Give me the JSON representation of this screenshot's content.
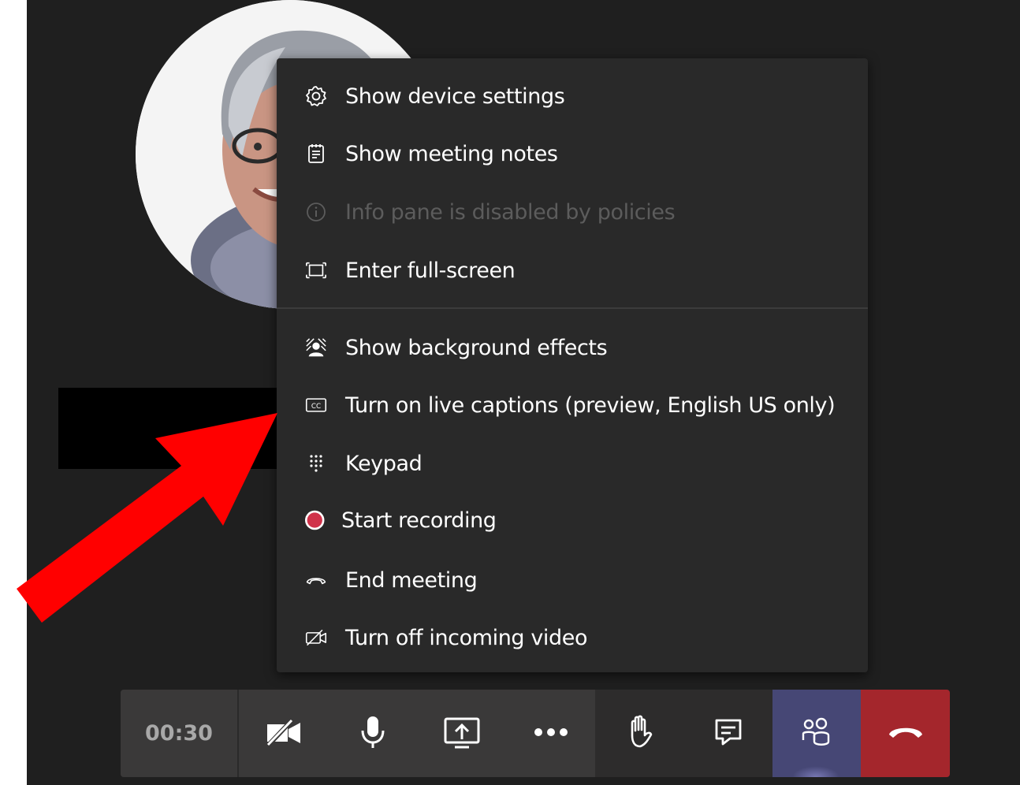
{
  "menu": {
    "items": [
      {
        "label": "Show device settings",
        "icon": "gear-icon",
        "disabled": false
      },
      {
        "label": "Show meeting notes",
        "icon": "notes-icon",
        "disabled": false
      },
      {
        "label": "Info pane is disabled by policies",
        "icon": "info-icon",
        "disabled": true
      },
      {
        "label": "Enter full-screen",
        "icon": "fullscreen-icon",
        "disabled": false
      },
      {
        "label": "Show background effects",
        "icon": "background-effects-icon",
        "disabled": false
      },
      {
        "label": "Turn on live captions (preview, English US only)",
        "icon": "closed-captions-icon",
        "disabled": false
      },
      {
        "label": "Keypad",
        "icon": "keypad-icon",
        "disabled": false
      },
      {
        "label": "Start recording",
        "icon": "record-icon",
        "disabled": false
      },
      {
        "label": "End meeting",
        "icon": "end-call-icon",
        "disabled": false
      },
      {
        "label": "Turn off incoming video",
        "icon": "video-off-icon",
        "disabled": false
      }
    ]
  },
  "toolbar": {
    "timer": "00:30",
    "buttons": [
      "camera-off-icon",
      "microphone-icon",
      "share-screen-icon",
      "more-options-icon",
      "raise-hand-icon",
      "chat-icon",
      "participants-icon",
      "hang-up-icon"
    ]
  },
  "colors": {
    "menu_bg": "#292929",
    "stage_bg": "#1f1f1f",
    "participants_active": "#464775",
    "hangup": "#a4262c",
    "record_dot": "#d0324a",
    "annotation_arrow": "#ff0000"
  }
}
